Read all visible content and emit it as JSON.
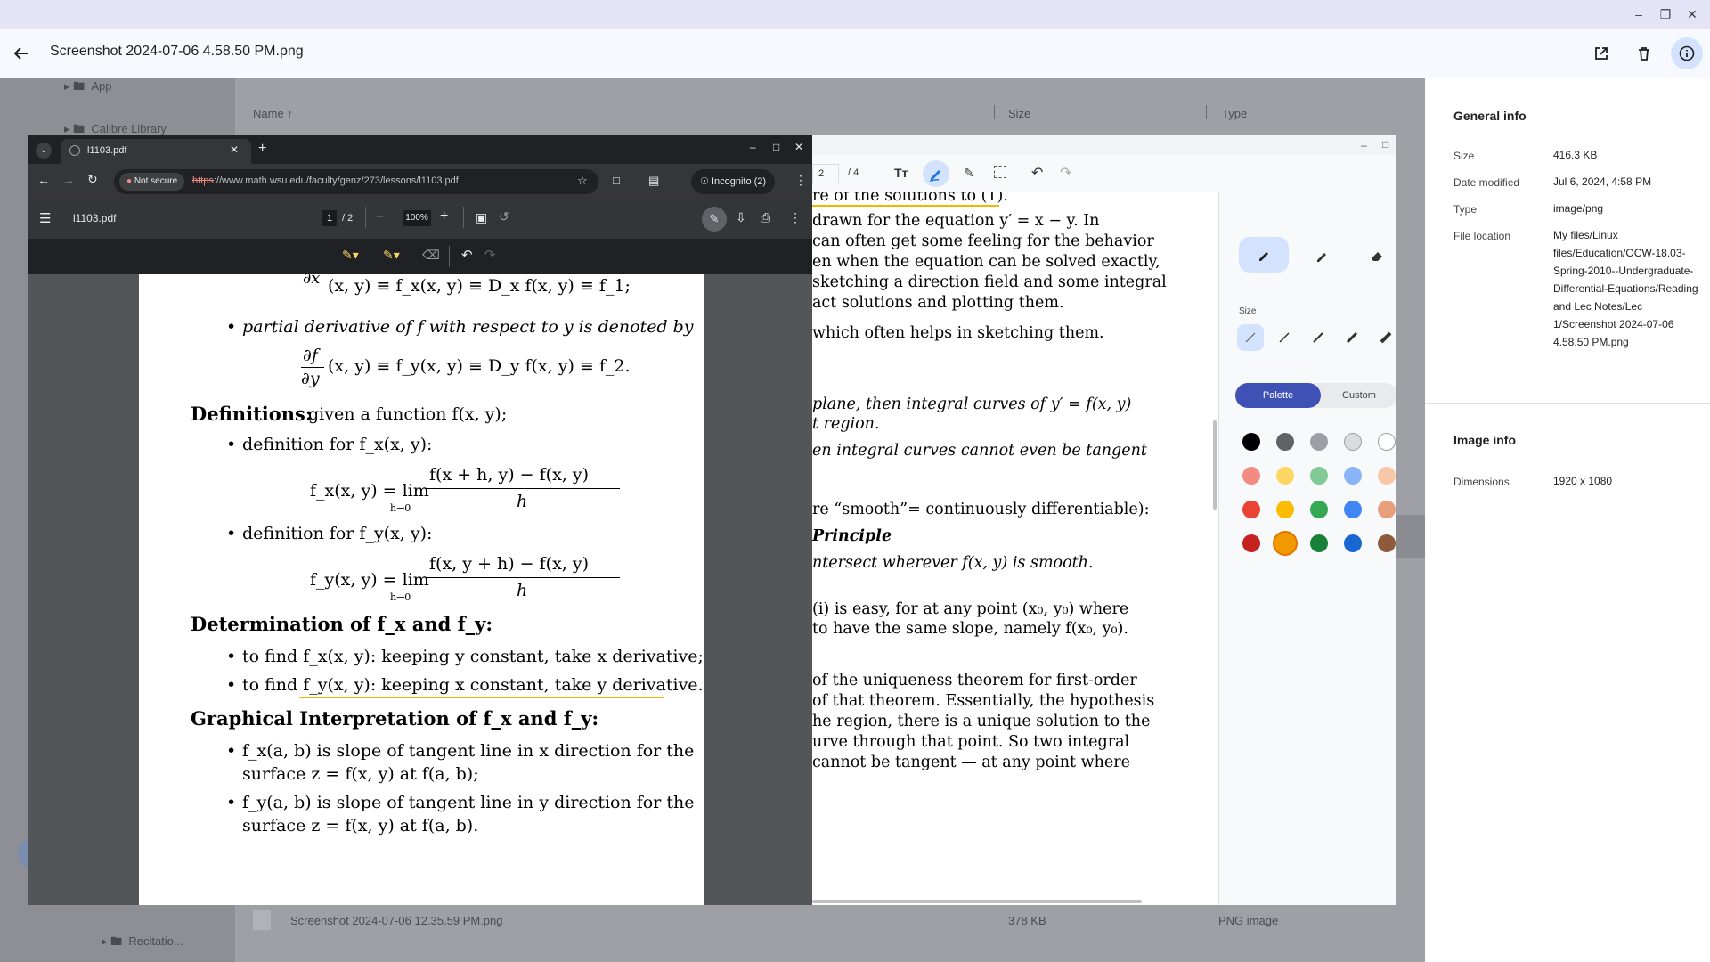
{
  "window": {
    "title": "Screenshot 2024-07-06 4.58.50 PM.png"
  },
  "file_manager": {
    "tree": [
      "App",
      "Calibre Library",
      "Recitatio..."
    ],
    "columns": {
      "name": "Name",
      "size": "Size",
      "type": "Type"
    },
    "rows": [
      {
        "name": "Screenshot 2024-07-06 12.35.59 PM.png",
        "size": "378 KB",
        "type": "PNG image"
      }
    ]
  },
  "info_panel": {
    "general_title": "General info",
    "fields": [
      {
        "label": "Size",
        "value": "416.3 KB"
      },
      {
        "label": "Date modified",
        "value": "Jul 6, 2024, 4:58 PM"
      },
      {
        "label": "Type",
        "value": "image/png"
      },
      {
        "label": "File location",
        "value": "My files/Linux files/Education/OCW-18.03-Spring-2010--Undergraduate-Differential-Equations/Reading and Lec Notes/Lec 1/Screenshot 2024-07-06 4.58.50 PM.png"
      }
    ],
    "image_title": "Image info",
    "image_fields": [
      {
        "label": "Dimensions",
        "value": "1920 x 1080"
      }
    ]
  },
  "browser": {
    "tab_title": "l1103.pdf",
    "security": "Not secure",
    "url_scheme": "https",
    "url_rest": "://www.math.wsu.edu/faculty/genz/273/lessons/l1103.pdf",
    "incognito": "Incognito (2)",
    "pdf": {
      "filename": "l1103.pdf",
      "page": "1",
      "page_total": "/ 2",
      "zoom": "100%"
    }
  },
  "pdf_content": {
    "line_partial_top": "(x, y) ≡ f_x(x, y) ≡ D_x f(x, y) ≡ f_1;",
    "partial_y_bullet": "partial derivative of f with respect to y is denoted by",
    "partial_y_formula": "(x, y) ≡ f_y(x, y) ≡ D_y f(x, y) ≡ f_2.",
    "definitions_head": "Definitions:",
    "definitions_rest": "given a function f(x, y);",
    "def_fx": "definition for f_x(x, y):",
    "def_fx_formula_lhs": "f_x(x, y) = lim",
    "def_fx_num": "f(x + h, y) − f(x, y)",
    "def_den": "h",
    "def_lim_sub": "h→0",
    "def_fy": "definition for f_y(x, y):",
    "def_fy_formula_lhs": "f_y(x, y) = lim",
    "def_fy_num": "f(x, y + h) − f(x, y)",
    "determination_head": "Determination of f_x and f_y:",
    "det_1": "to find f_x(x, y): keeping y constant, take x derivative;",
    "det_2": "to find f_y(x, y): keeping x constant, take y derivative.",
    "graphical_head": "Graphical Interpretation of f_x and f_y:",
    "graph_1a": "f_x(a, b) is slope of tangent line in x direction for the",
    "graph_1b": "surface z = f(x, y) at f(a, b);",
    "graph_2a": "f_y(a, b) is slope of tangent line in y direction for the",
    "graph_2b": "surface z = f(x, y) at f(a, b)."
  },
  "second_pdf": {
    "page_current": "2",
    "page_total": "/ 4",
    "lines": [
      "re of the solutions to (1).",
      " drawn for the equation y′ = x − y.  In",
      " can often get some feeling for the behavior",
      "en when the equation can be solved exactly,",
      "sketching a direction field and some integral",
      "act solutions and plotting them.",
      "which often helps in sketching them.",
      "plane, then integral curves of  y′ = f(x, y)",
      "t region.",
      "en integral curves cannot even be tangent",
      "re “smooth”= continuously differentiable):",
      "Principle",
      "ntersect wherever f(x, y) is smooth.",
      "(i) is easy, for at any point (x₀, y₀) where",
      " to have the same slope, namely f(x₀, y₀).",
      "of the uniqueness theorem for first-order",
      "of that theorem.  Essentially, the hypothesis",
      "he region, there is a unique solution to the",
      "urve through that point.  So two integral",
      "cannot be tangent — at any point where"
    ],
    "size_label": "Size",
    "palette_label": "Palette",
    "custom_label": "Custom",
    "colors": [
      "#000000",
      "#5f6368",
      "#9aa0a6",
      "#dadce0",
      "#ffffff",
      "#f28b82",
      "#fdd663",
      "#81c995",
      "#8ab4f8",
      "#f6c8a8",
      "#ea4335",
      "#fbbc04",
      "#34a853",
      "#4285f4",
      "#e8a07c",
      "#c5221f",
      "#f29900",
      "#188038",
      "#1967d2",
      "#8d5a3b"
    ]
  }
}
